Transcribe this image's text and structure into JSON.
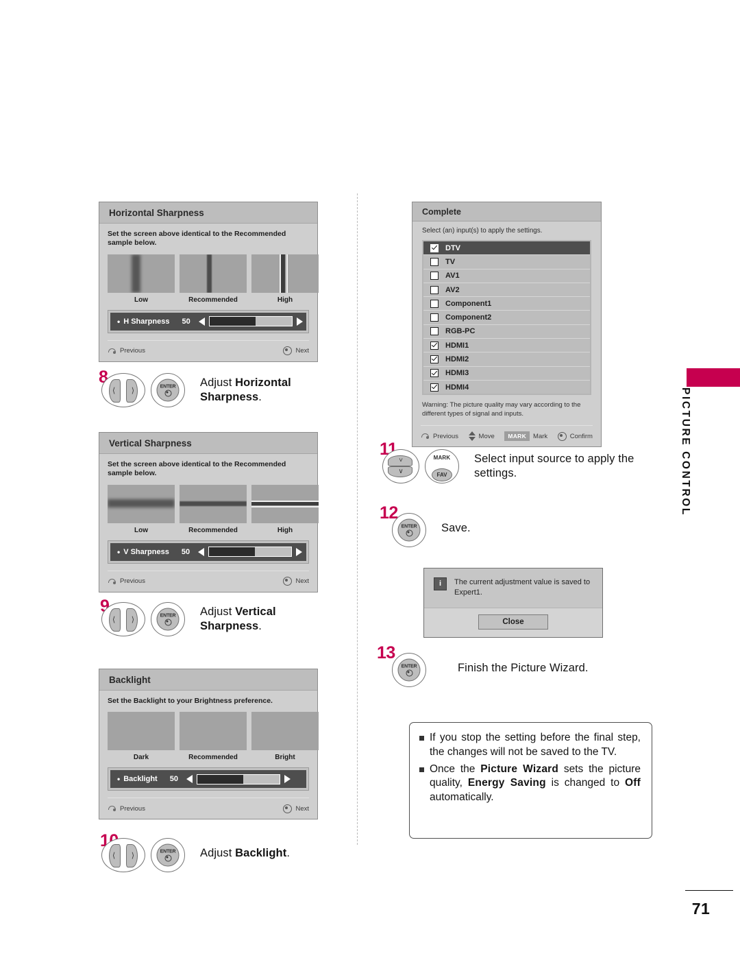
{
  "page": {
    "number": "71",
    "side_tab_label": "PICTURE CONTROL",
    "accent_color": "#c6004f"
  },
  "panels": {
    "horizontal_sharpness": {
      "title": "Horizontal Sharpness",
      "instruction": "Set the screen above identical to the Recommended sample below.",
      "samples": [
        {
          "caption": "Low"
        },
        {
          "caption": "Recommended"
        },
        {
          "caption": "High"
        }
      ],
      "slider": {
        "label": "H Sharpness",
        "value": "50"
      },
      "footer": {
        "previous": "Previous",
        "next": "Next"
      }
    },
    "vertical_sharpness": {
      "title": "Vertical Sharpness",
      "instruction": "Set the screen above identical to the Recommended sample below.",
      "samples": [
        {
          "caption": "Low"
        },
        {
          "caption": "Recommended"
        },
        {
          "caption": "High"
        }
      ],
      "slider": {
        "label": "V Sharpness",
        "value": "50"
      },
      "footer": {
        "previous": "Previous",
        "next": "Next"
      }
    },
    "backlight": {
      "title": "Backlight",
      "instruction": "Set the Backlight to your Brightness preference.",
      "samples": [
        {
          "caption": "Dark"
        },
        {
          "caption": "Recommended"
        },
        {
          "caption": "Bright"
        }
      ],
      "slider": {
        "label": "Backlight",
        "value": "50"
      },
      "footer": {
        "previous": "Previous",
        "next": "Next"
      }
    },
    "complete": {
      "title": "Complete",
      "instruction": "Select (an) input(s) to apply the settings.",
      "inputs": [
        {
          "label": "DTV",
          "checked": true,
          "selected": true
        },
        {
          "label": "TV",
          "checked": false,
          "selected": false
        },
        {
          "label": "AV1",
          "checked": false,
          "selected": false
        },
        {
          "label": "AV2",
          "checked": false,
          "selected": false
        },
        {
          "label": "Component1",
          "checked": false,
          "selected": false
        },
        {
          "label": "Component2",
          "checked": false,
          "selected": false
        },
        {
          "label": "RGB-PC",
          "checked": false,
          "selected": false
        },
        {
          "label": "HDMI1",
          "checked": true,
          "selected": false
        },
        {
          "label": "HDMI2",
          "checked": true,
          "selected": false
        },
        {
          "label": "HDMI3",
          "checked": true,
          "selected": false
        },
        {
          "label": "HDMI4",
          "checked": true,
          "selected": false
        }
      ],
      "warning": "Warning: The picture quality may vary according to the different types of signal and inputs.",
      "footer": {
        "previous": "Previous",
        "move": "Move",
        "mark_key": "MARK",
        "mark": "Mark",
        "confirm": "Confirm"
      }
    }
  },
  "steps": {
    "s8": {
      "number": "8",
      "enter_label": "ENTER",
      "text_prefix": "Adjust ",
      "text_bold": "Horizontal Sharpness",
      "text_suffix": "."
    },
    "s9": {
      "number": "9",
      "enter_label": "ENTER",
      "text_prefix": "Adjust ",
      "text_bold": "Vertical Sharpness",
      "text_suffix": "."
    },
    "s10": {
      "number": "10",
      "enter_label": "ENTER",
      "text_prefix": "Adjust ",
      "text_bold": "Backlight",
      "text_suffix": "."
    },
    "s11": {
      "number": "11",
      "mark_label": "MARK",
      "fav_label": "FAV",
      "text": "Select input source to apply the settings."
    },
    "s12": {
      "number": "12",
      "enter_label": "ENTER",
      "text": "Save."
    },
    "s13": {
      "number": "13",
      "enter_label": "ENTER",
      "text": "Finish the Picture Wizard."
    }
  },
  "saved_dialog": {
    "message": "The current adjustment value is saved to Expert1.",
    "info_glyph": "i",
    "close_label": "Close"
  },
  "notes": [
    {
      "parts": [
        {
          "t": "If you stop the setting before the final step, the changes will not be saved to the TV.",
          "b": false
        }
      ]
    },
    {
      "parts": [
        {
          "t": "Once the ",
          "b": false
        },
        {
          "t": "Picture Wizard",
          "b": true
        },
        {
          "t": " sets the picture quality, ",
          "b": false
        },
        {
          "t": "Energy Saving",
          "b": true
        },
        {
          "t": " is changed to ",
          "b": false
        },
        {
          "t": "Off",
          "b": true
        },
        {
          "t": " automatically.",
          "b": false
        }
      ]
    }
  ]
}
